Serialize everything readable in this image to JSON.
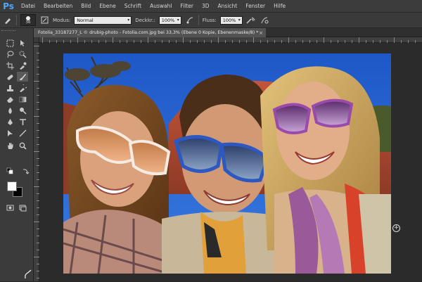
{
  "app": {
    "logo": "Ps"
  },
  "menu": [
    "Datei",
    "Bearbeiten",
    "Bild",
    "Ebene",
    "Schrift",
    "Auswahl",
    "Filter",
    "3D",
    "Ansicht",
    "Fenster",
    "Hilfe"
  ],
  "options": {
    "brush_size": "36",
    "modus_label": "Modus:",
    "modus_value": "Normal",
    "deckkraft_label": "Deckkr.:",
    "deckkraft_value": "100%",
    "fluss_label": "Fluss:",
    "fluss_value": "100%"
  },
  "document": {
    "tab_title": "Fotolia_33187277_L © drubig-photo - Fotolia.com.jpg bei 33,3% (Ebene 0 Kopie, Ebenenmaske/8) *",
    "close": "×"
  },
  "colors": {
    "foreground": "#ffffff",
    "background": "#000000",
    "accent": "#4fa6ff"
  },
  "icons": [
    "move-icon",
    "marquee-icon",
    "lasso-icon",
    "quick-select-icon",
    "crop-icon",
    "eyedropper-icon",
    "healing-icon",
    "brush-icon",
    "clone-stamp-icon",
    "history-brush-icon",
    "eraser-icon",
    "gradient-icon",
    "blur-icon",
    "dodge-icon",
    "pen-icon",
    "type-icon",
    "path-select-icon",
    "shape-icon",
    "hand-icon",
    "zoom-icon"
  ]
}
